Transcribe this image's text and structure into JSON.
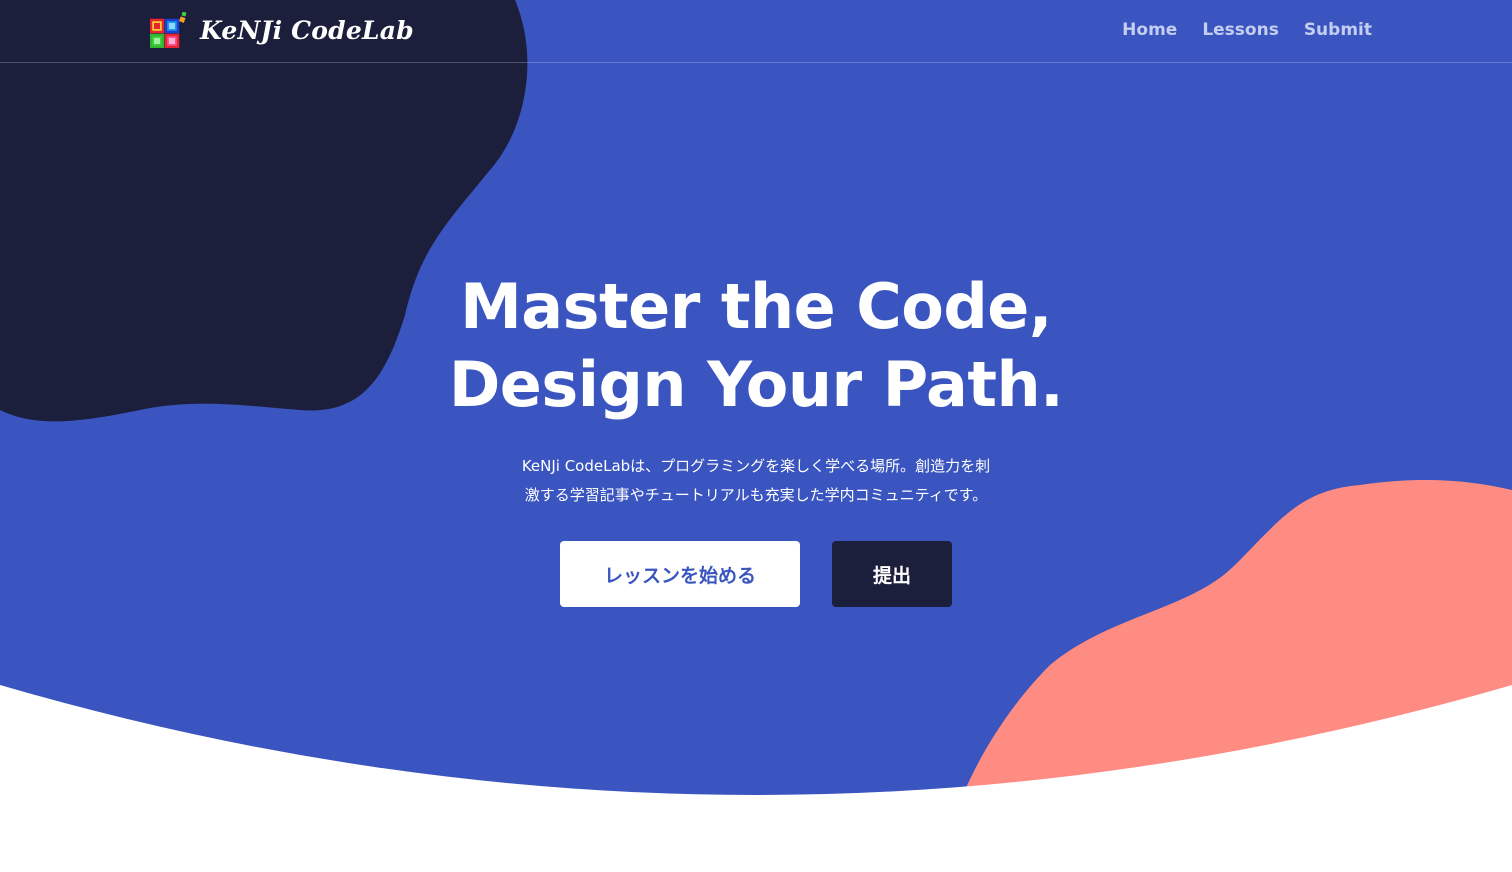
{
  "brand": {
    "name": "KeNJi CodeLab",
    "logo_icon": "colorful-squares-logo-icon"
  },
  "nav": {
    "items": [
      {
        "label": "Home"
      },
      {
        "label": "Lessons"
      },
      {
        "label": "Submit"
      }
    ]
  },
  "hero": {
    "headline_line1": "Master the Code,",
    "headline_line2": "Design Your Path.",
    "subtitle_line1": "KeNJi CodeLabは、プログラミングを楽しく学べる場所。創造力を刺",
    "subtitle_line2": "激する学習記事やチュートリアルも充実した学内コミュニティです。",
    "primary_button": "レッスンを始める",
    "secondary_button": "提出"
  },
  "colors": {
    "hero_blue": "#3a55bf",
    "navy_blob": "#1c1f3b",
    "coral_blob": "#ff8c82",
    "page_white": "#ffffff",
    "nav_link": "#c5cdf0"
  }
}
